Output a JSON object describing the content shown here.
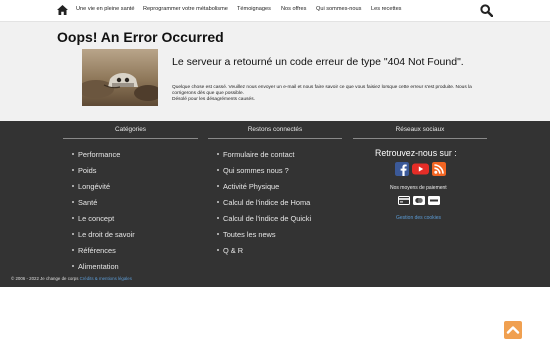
{
  "nav": {
    "items": [
      {
        "label": "Une vie en pleine santé"
      },
      {
        "label": "Reprogrammer votre métabolisme"
      },
      {
        "label": "Témoignages"
      },
      {
        "label": "Nos offres"
      },
      {
        "label": "Qui sommes-nous"
      },
      {
        "label": "Les recettes"
      }
    ]
  },
  "error": {
    "title": "Oops! An Error Occurred",
    "heading": "Le serveur a retourné un code erreur de type \"404 Not Found\".",
    "line1": "Quelque chose est cassé. Veuillez nous envoyer un e-mail et nous faire savoir ce que vous faisiez lorsque cette erreur s'est produite. Nous la corrigerons dès que que possible.",
    "line2": "Désolé pour les désagréments causés."
  },
  "footer": {
    "categories_title": "Catégories",
    "categories": [
      {
        "label": "Performance"
      },
      {
        "label": "Poids"
      },
      {
        "label": "Longévité"
      },
      {
        "label": "Santé"
      },
      {
        "label": "Le concept"
      },
      {
        "label": "Le droit de savoir"
      },
      {
        "label": "Références"
      },
      {
        "label": "Alimentation"
      }
    ],
    "connected_title": "Restons connectés",
    "connected": [
      {
        "label": "Formulaire de contact"
      },
      {
        "label": "Qui sommes nous ?"
      },
      {
        "label": "Activité Physique"
      },
      {
        "label": "Calcul de l'indice de Homa"
      },
      {
        "label": "Calcul de l'indice de Quicki"
      },
      {
        "label": "Toutes les news"
      },
      {
        "label": "Q & R"
      }
    ],
    "social_title": "Réseaux sociaux",
    "retrouvez": "Retrouvez-nous sur :",
    "payment_label": "Nos moyens de paiement",
    "cookies": "Gestion des cookies",
    "copyright": "© 2006 - 2022 Je change de corps",
    "legal_link": "Crédits & mentions légales"
  },
  "colors": {
    "footer_bg": "#333333",
    "accent_link": "#5b9bd5",
    "facebook": "#3b5998",
    "youtube": "#e52d27",
    "rss": "#f26522",
    "scroll_top": "#f0a050"
  }
}
